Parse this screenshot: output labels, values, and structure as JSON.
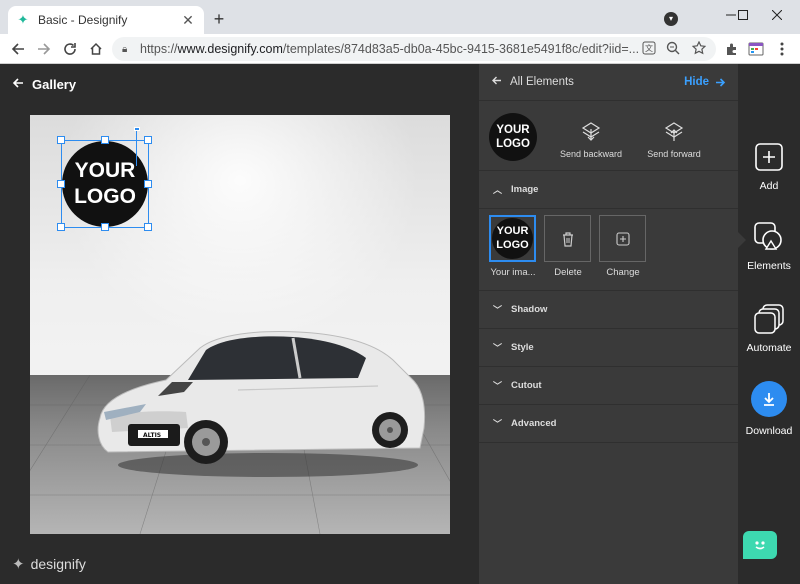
{
  "browser": {
    "tab_title": "Basic - Designify",
    "tab_close": "✕",
    "new_tab": "+",
    "url_prefix": "https://",
    "url_host": "www.designify.com",
    "url_path": "/templates/874d83a5-db0a-45bc-9415-3681e5491f8c/edit?iid=...",
    "window_controls": [
      "minimize",
      "maximize",
      "close"
    ]
  },
  "app": {
    "back_label": "Gallery",
    "brand_name": "designify",
    "canvas_logo": {
      "line1": "YOUR",
      "line2": "LOGO"
    }
  },
  "panel": {
    "header_label": "All Elements",
    "hide_label": "Hide",
    "thumb_logo": {
      "line1": "YOUR",
      "line2": "LOGO"
    },
    "send_backward": "Send backward",
    "send_forward": "Send forward",
    "sections": {
      "image": "Image",
      "shadow": "Shadow",
      "style": "Style",
      "cutout": "Cutout",
      "advanced": "Advanced"
    },
    "image_tiles": {
      "current_label": "Your ima...",
      "delete_label": "Delete",
      "change_label": "Change",
      "current_logo": {
        "line1": "YOUR",
        "line2": "LOGO"
      }
    }
  },
  "rail": {
    "add": "Add",
    "elements": "Elements",
    "automate": "Automate",
    "download": "Download"
  },
  "colors": {
    "accent": "#2d8cf0",
    "chat": "#3dd9b0",
    "panel_bg": "#3a3a3a",
    "app_bg": "#2b2b2b"
  }
}
